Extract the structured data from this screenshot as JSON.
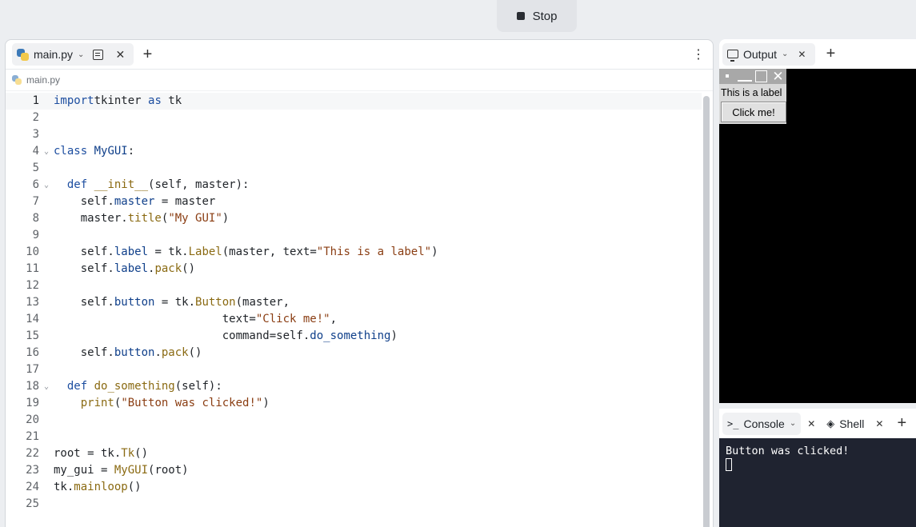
{
  "top": {
    "stop_label": "Stop"
  },
  "editor": {
    "tab_label": "main.py",
    "breadcrumb": "main.py",
    "lines": [
      {
        "n": "1",
        "tokens": [
          [
            "kw",
            "import"
          ],
          [
            "",
            "tkinter "
          ],
          [
            "kw",
            "as"
          ],
          [
            "",
            " tk"
          ]
        ]
      },
      {
        "n": "2",
        "tokens": []
      },
      {
        "n": "3",
        "tokens": []
      },
      {
        "n": "4",
        "fold": true,
        "tokens": [
          [
            "kw",
            "class"
          ],
          [
            "",
            " "
          ],
          [
            "attr",
            "MyGUI"
          ],
          [
            "",
            ":"
          ]
        ]
      },
      {
        "n": "5",
        "tokens": []
      },
      {
        "n": "6",
        "fold": true,
        "tokens": [
          [
            "",
            "  "
          ],
          [
            "kw",
            "def"
          ],
          [
            "",
            " "
          ],
          [
            "fn",
            "__init__"
          ],
          [
            "",
            "(self, master):"
          ]
        ]
      },
      {
        "n": "7",
        "tokens": [
          [
            "",
            "    self."
          ],
          [
            "attr",
            "master"
          ],
          [
            "",
            " = master"
          ]
        ]
      },
      {
        "n": "8",
        "tokens": [
          [
            "",
            "    master."
          ],
          [
            "fn",
            "title"
          ],
          [
            "",
            "("
          ],
          [
            "str",
            "\"My GUI\""
          ],
          [
            "",
            ")"
          ]
        ]
      },
      {
        "n": "9",
        "tokens": []
      },
      {
        "n": "10",
        "tokens": [
          [
            "",
            "    self."
          ],
          [
            "attr",
            "label"
          ],
          [
            "",
            " = tk."
          ],
          [
            "fn",
            "Label"
          ],
          [
            "",
            "(master, text="
          ],
          [
            "str",
            "\"This is a label\""
          ],
          [
            "",
            ")"
          ]
        ]
      },
      {
        "n": "11",
        "tokens": [
          [
            "",
            "    self."
          ],
          [
            "attr",
            "label"
          ],
          [
            "",
            "."
          ],
          [
            "fn",
            "pack"
          ],
          [
            "",
            "()"
          ]
        ]
      },
      {
        "n": "12",
        "tokens": []
      },
      {
        "n": "13",
        "tokens": [
          [
            "",
            "    self."
          ],
          [
            "attr",
            "button"
          ],
          [
            "",
            " = tk."
          ],
          [
            "fn",
            "Button"
          ],
          [
            "",
            "(master,"
          ]
        ]
      },
      {
        "n": "14",
        "tokens": [
          [
            "",
            "                         text="
          ],
          [
            "str",
            "\"Click me!\""
          ],
          [
            "",
            ","
          ]
        ]
      },
      {
        "n": "15",
        "tokens": [
          [
            "",
            "                         command=self."
          ],
          [
            "attr",
            "do_something"
          ],
          [
            "",
            ")"
          ]
        ]
      },
      {
        "n": "16",
        "tokens": [
          [
            "",
            "    self."
          ],
          [
            "attr",
            "button"
          ],
          [
            "",
            "."
          ],
          [
            "fn",
            "pack"
          ],
          [
            "",
            "()"
          ]
        ]
      },
      {
        "n": "17",
        "tokens": []
      },
      {
        "n": "18",
        "fold": true,
        "tokens": [
          [
            "",
            "  "
          ],
          [
            "kw",
            "def"
          ],
          [
            "",
            " "
          ],
          [
            "fn",
            "do_something"
          ],
          [
            "",
            "(self):"
          ]
        ]
      },
      {
        "n": "19",
        "tokens": [
          [
            "",
            "    "
          ],
          [
            "fn",
            "print"
          ],
          [
            "",
            "("
          ],
          [
            "str",
            "\"Button was clicked!\""
          ],
          [
            "",
            ")"
          ]
        ]
      },
      {
        "n": "20",
        "tokens": []
      },
      {
        "n": "21",
        "tokens": []
      },
      {
        "n": "22",
        "tokens": [
          [
            "",
            "root = tk."
          ],
          [
            "fn",
            "Tk"
          ],
          [
            "",
            "()"
          ]
        ]
      },
      {
        "n": "23",
        "tokens": [
          [
            "",
            "my_gui = "
          ],
          [
            "fn",
            "MyGUI"
          ],
          [
            "",
            "(root)"
          ]
        ]
      },
      {
        "n": "24",
        "tokens": [
          [
            "",
            "tk."
          ],
          [
            "fn",
            "mainloop"
          ],
          [
            "",
            "()"
          ]
        ]
      },
      {
        "n": "25",
        "tokens": []
      }
    ]
  },
  "output": {
    "tab_label": "Output",
    "tk_label": "This is a label",
    "tk_button": "Click me!"
  },
  "console": {
    "tab_label": "Console",
    "shell_label": "Shell",
    "output_line": "Button was clicked!"
  }
}
